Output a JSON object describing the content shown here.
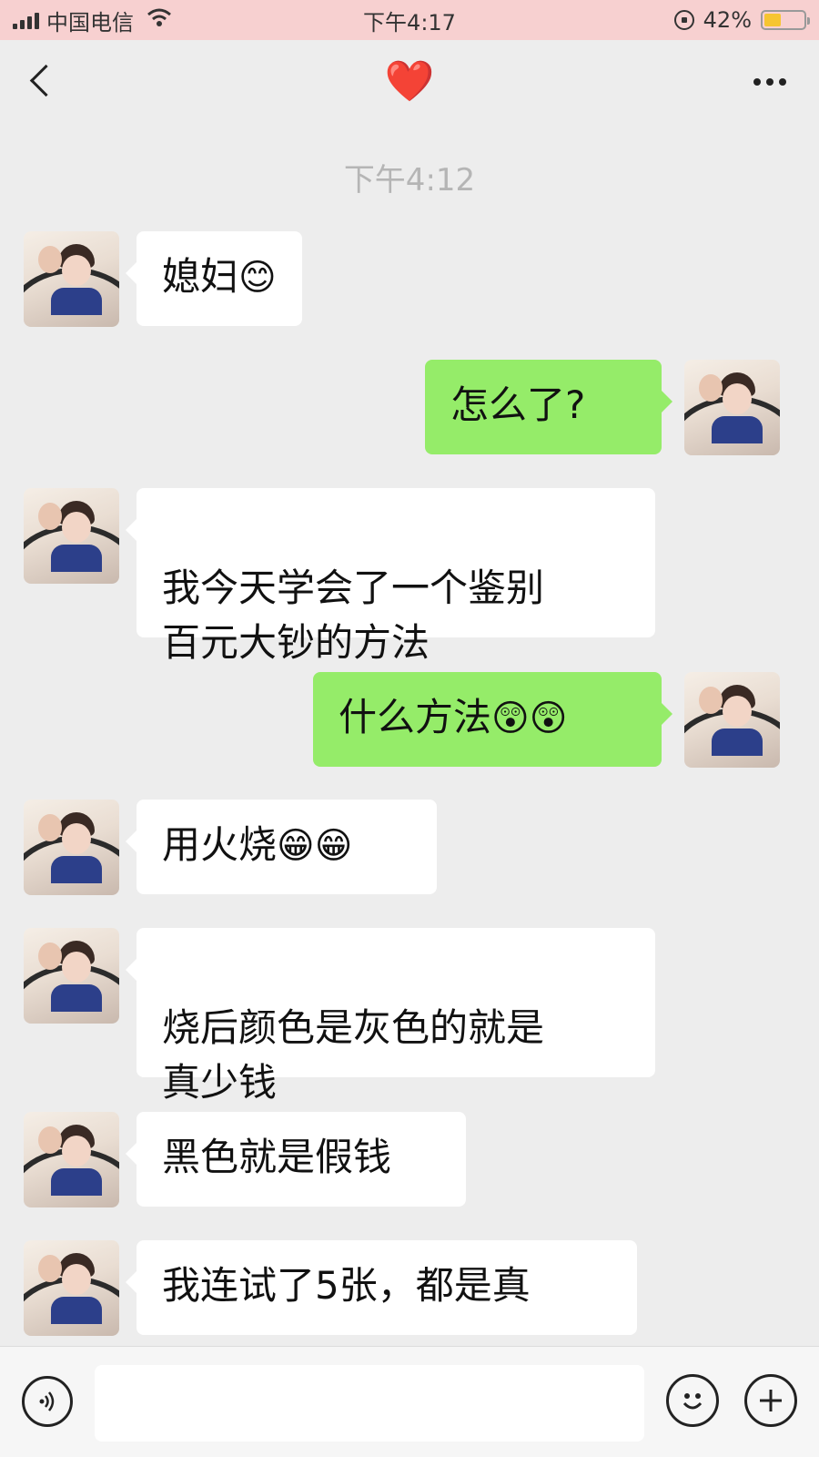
{
  "status_bar": {
    "carrier": "中国电信",
    "time": "下午4:17",
    "battery_percent": "42%",
    "battery_level": 0.42,
    "icons": [
      "signal-icon",
      "wifi-icon",
      "rotation-lock-icon",
      "battery-icon"
    ]
  },
  "nav": {
    "title": "❤️",
    "back_icon": "chevron-left-icon",
    "more_icon": "more-dots-icon"
  },
  "conversation": {
    "timestamp": "下午4:12",
    "messages": [
      {
        "side": "left",
        "text": "媳妇",
        "emoji": "😊"
      },
      {
        "side": "right",
        "text": "怎么了?",
        "emoji": ""
      },
      {
        "side": "left",
        "text": "我今天学会了一个鉴别\n百元大钞的方法",
        "emoji": ""
      },
      {
        "side": "right",
        "text": "什么方法",
        "emoji": "😲😲"
      },
      {
        "side": "left",
        "text": "用火烧",
        "emoji": "😁😁"
      },
      {
        "side": "left",
        "text": "烧后颜色是灰色的就是\n真少钱",
        "emoji": ""
      },
      {
        "side": "left",
        "text": "黑色就是假钱",
        "emoji": ""
      },
      {
        "side": "left",
        "text": "我连试了5张，都是真",
        "emoji": ""
      }
    ]
  },
  "input_bar": {
    "voice_icon": "voice-icon",
    "emoji_icon": "emoji-icon",
    "plus_icon": "plus-icon",
    "message_value": ""
  }
}
